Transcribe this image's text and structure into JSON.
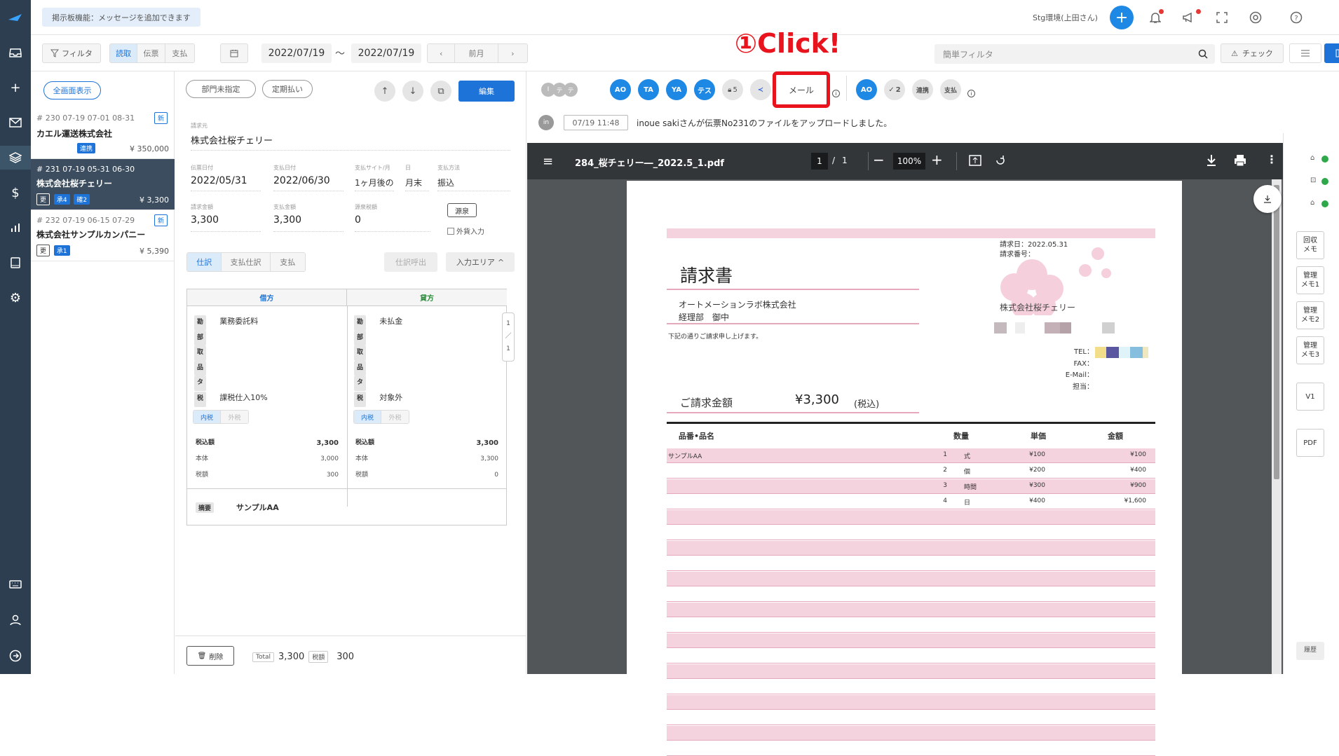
{
  "topbar": {
    "notice": "掲示板機能：メッセージを追加できます",
    "env_user": "Stg環境(上田さん)"
  },
  "filterbar": {
    "filter_label": "フィルタ",
    "seg": [
      "読取",
      "伝票",
      "支払"
    ],
    "date_from": "2022/07/19",
    "date_sep": "〜",
    "date_to": "2022/07/19",
    "prev_month": "前月",
    "search_placeholder": "簡単フィルタ",
    "check_label": "チェック"
  },
  "annotation": {
    "text": "①Click!",
    "color": "#e8131d"
  },
  "list": {
    "show_all": "全画面表示",
    "items": [
      {
        "meta": "# 230   07-19   07-01   08-31",
        "new": "新",
        "name": "カエル運送株式会社",
        "badges": [
          "連携"
        ],
        "amount": "¥ 350,000"
      },
      {
        "meta": "# 231   07-19   05-31   06-30",
        "new": "",
        "name": "株式会社桜チェリー",
        "badges": [
          "更",
          "承4",
          "確2"
        ],
        "amount": "¥ 3,300"
      },
      {
        "meta": "# 232   07-19   06-15   07-29",
        "new": "新",
        "name": "株式会社サンプルカンパニー",
        "badges": [
          "更",
          "承1"
        ],
        "amount": "¥ 5,390"
      }
    ]
  },
  "detail": {
    "pill1": "部門未指定",
    "pill2": "定期払い",
    "edit": "編集",
    "lbl_vendor": "請求元",
    "vendor": "株式会社桜チェリー",
    "lbl_date": "伝票日付",
    "date": "2022/05/31",
    "lbl_paydate": "支払日付",
    "paydate": "2022/06/30",
    "lbl_site": "支払サイト/月",
    "site": "1ヶ月後の",
    "lbl_day": "日",
    "day": "月末",
    "lbl_method": "支払方法",
    "method": "振込",
    "lbl_amount": "請求金額",
    "amount": "3,300",
    "lbl_payamt": "支払金額",
    "payamt": "3,300",
    "lbl_tax": "源泉税額",
    "tax": "0",
    "gensen": "源泉",
    "gaika": "外貨入力",
    "tabs": [
      "仕訳",
      "支払仕訳",
      "支払"
    ],
    "yobidashi": "仕訳呼出",
    "input_area": "入力エリア",
    "debit_head": "借方",
    "credit_head": "貸方",
    "debit": {
      "kamoku": "業務委託料",
      "zei": "課税仕入10%",
      "incl": "内税",
      "excl": "外税",
      "r1": "税込額",
      "v1": "3,300",
      "r2": "本体",
      "v2": "3,000",
      "r3": "税額",
      "v3": "300"
    },
    "credit": {
      "kamoku": "未払金",
      "zei": "対象外",
      "incl": "内税",
      "excl": "外税",
      "r1": "税込額",
      "v1": "3,300",
      "r2": "本体",
      "v2": "3,300",
      "r3": "税額",
      "v3": "0"
    },
    "tag_labels": [
      "勘",
      "部",
      "取",
      "品",
      "タ",
      "税"
    ],
    "pager": [
      "1",
      "／",
      "1"
    ],
    "memo_lbl": "摘要",
    "memo": "サンプルAA",
    "delete": "削除",
    "total_lbl": "Total",
    "total": "3,300",
    "totaltax_lbl": "税額",
    "totaltax": "300"
  },
  "right": {
    "small_avatars": [
      "I",
      "テ",
      "テ"
    ],
    "avatars": [
      "AO",
      "TA",
      "YA",
      "テス"
    ],
    "lock_count": "5",
    "mail": "メール",
    "avatar2": "AO",
    "check_count": "2",
    "renkei": "連携",
    "shiharai": "支払",
    "log_user": "in",
    "log_time": "07/19 11:48",
    "log_text": "inoue sakiさんが伝票No231のファイルをアップロードしました。"
  },
  "pdf": {
    "filename": "284_桜チェリー―_2022.5_1.pdf",
    "page": "1",
    "of": "/",
    "total": "1",
    "zoom": "100%",
    "doc_date": "請求日：2022.05.31",
    "doc_no": "請求番号：",
    "title": "請求書",
    "to_company": "オートメーションラボ株式会社",
    "to_dept": "経理部　御中",
    "intro": "下記の通りご請求申し上げます。",
    "from_company": "株式会社桜チェリー",
    "tel": "TEL：",
    "fax": "FAX：",
    "email": "E-Mail：",
    "tanto": "担当：",
    "total_label": "ご請求金額",
    "total_value": "¥3,300",
    "total_note": "(税込)",
    "col_item": "品番•品名",
    "col_qty": "数量",
    "col_price": "単価",
    "col_amount": "金額",
    "rows": [
      {
        "item": "サンプルAA",
        "qty": "1",
        "unit": "式",
        "price": "¥100",
        "amount": "¥100"
      },
      {
        "item": "",
        "qty": "2",
        "unit": "個",
        "price": "¥200",
        "amount": "¥400"
      },
      {
        "item": "",
        "qty": "3",
        "unit": "時間",
        "price": "¥300",
        "amount": "¥900"
      },
      {
        "item": "",
        "qty": "4",
        "unit": "日",
        "price": "¥400",
        "amount": "¥1,600"
      }
    ]
  },
  "rsidebar": {
    "kaishu": "回収\nメモ",
    "kanri1": "管理\nメモ1",
    "kanri2": "管理\nメモ2",
    "kanri3": "管理\nメモ3",
    "v1": "V1",
    "pdf": "PDF",
    "rireki": "履歴"
  }
}
